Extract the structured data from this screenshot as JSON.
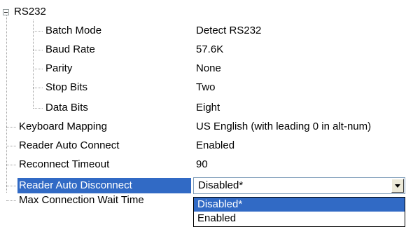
{
  "tree": {
    "root": {
      "label": "RS232",
      "expanded": true
    },
    "rs232_children": [
      {
        "label": "Batch Mode",
        "value": "Detect RS232"
      },
      {
        "label": "Baud Rate",
        "value": "57.6K"
      },
      {
        "label": "Parity",
        "value": "None"
      },
      {
        "label": "Stop Bits",
        "value": "Two"
      },
      {
        "label": "Data Bits",
        "value": "Eight"
      }
    ],
    "top_items": [
      {
        "label": "Keyboard Mapping",
        "value": "US English (with leading 0 in alt-num)"
      },
      {
        "label": "Reader Auto Connect",
        "value": "Enabled"
      },
      {
        "label": "Reconnect Timeout",
        "value": "90"
      },
      {
        "label": "Reader Auto Disconnect",
        "selected": true
      },
      {
        "label": "Max Connection Wait Time",
        "value": ""
      }
    ]
  },
  "dropdown": {
    "current_value": "Disabled*",
    "options": [
      "Disabled*",
      "Enabled"
    ],
    "highlighted_index": 0,
    "accent_color": "#316ac5"
  }
}
